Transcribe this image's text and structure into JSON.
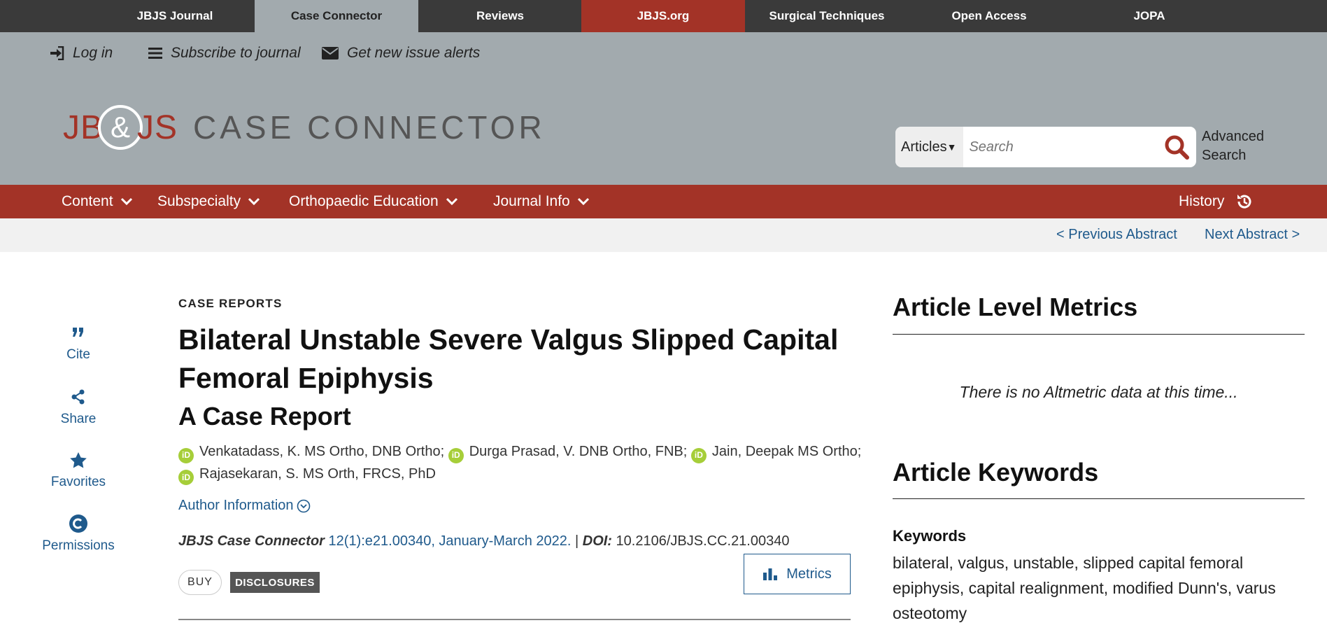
{
  "top_tabs": [
    {
      "label": "JBJS Journal"
    },
    {
      "label": "Case Connector"
    },
    {
      "label": "Reviews"
    },
    {
      "label": "JBJS.org"
    },
    {
      "label": "Surgical Techniques"
    },
    {
      "label": "Open Access"
    },
    {
      "label": "JOPA"
    }
  ],
  "header": {
    "login": "Log in",
    "subscribe": "Subscribe to journal",
    "alerts": "Get new issue alerts",
    "logo_left": "JB",
    "logo_amp": "&",
    "logo_right": "JS",
    "logo_name": "CASE CONNECTOR"
  },
  "search": {
    "scope": "Articles",
    "placeholder": "Search",
    "advanced_line1": "Advanced",
    "advanced_line2": "Search"
  },
  "nav": {
    "items": [
      "Content",
      "Subspecialty",
      "Orthopaedic Education",
      "Journal Info"
    ],
    "history": "History"
  },
  "abstract_nav": {
    "prev": "< Previous Abstract",
    "next": "Next Abstract >"
  },
  "tools": [
    {
      "label": "Cite",
      "icon": "quote-icon"
    },
    {
      "label": "Share",
      "icon": "share-icon"
    },
    {
      "label": "Favorites",
      "icon": "star-icon"
    },
    {
      "label": "Permissions",
      "icon": "copyright-icon"
    }
  ],
  "article": {
    "section": "CASE REPORTS",
    "title": "Bilateral Unstable Severe Valgus Slipped Capital Femoral Epiphysis",
    "subtitle": "A Case Report",
    "authors": [
      "Venkatadass, K. MS Ortho, DNB Ortho;",
      "Durga Prasad, V. DNB Ortho, FNB;",
      "Jain, Deepak MS Ortho;",
      "Rajasekaran, S. MS Orth, FRCS, PhD"
    ],
    "orcid_label": "iD",
    "author_info": "Author Information",
    "journal": "JBJS Case Connector",
    "volume": "12(1):e21.00340, January-March 2022.",
    "separator": "|",
    "doi_label": "DOI:",
    "doi": "10.2106/JBJS.CC.21.00340",
    "buy": "BUY",
    "disclosures": "DISCLOSURES",
    "metrics_button": "Metrics"
  },
  "sidebar": {
    "metrics_heading": "Article Level Metrics",
    "no_altmetric": "There is no Altmetric data at this time...",
    "keywords_heading": "Article Keywords",
    "keywords_label": "Keywords",
    "keywords": "bilateral, valgus, unstable, slipped capital femoral epiphysis, capital realignment, modified Dunn's, varus osteotomy"
  },
  "colors": {
    "brand_red": "#a33327",
    "header_grey": "#a2aaae",
    "link_blue": "#1f5a8c",
    "orcid_green": "#a6ce39"
  }
}
